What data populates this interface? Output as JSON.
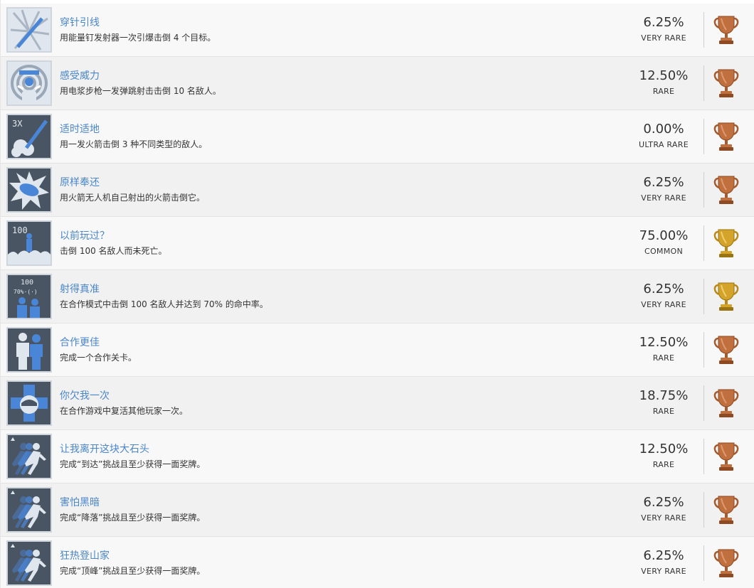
{
  "colors": {
    "title": "#4a86c8",
    "text": "#333333",
    "bronze": "#c0703f",
    "gold": "#d4a32a",
    "icon_bg": "#4a5563",
    "icon_blue": "#4a86d8",
    "icon_light": "#dfe6ee"
  },
  "achievements": [
    {
      "title": "穿针引线",
      "description": "用能量钉发射器一次引爆击倒 4 个目标。",
      "percent": "6.25%",
      "rarity": "VERY RARE",
      "trophy": "bronze",
      "icon": "nail-gun-burst-icon"
    },
    {
      "title": "感受威力",
      "description": "用电浆步枪一发弹跳射击击倒 10 名敌人。",
      "percent": "12.50%",
      "rarity": "RARE",
      "trophy": "bronze",
      "icon": "plasma-rifle-shock-icon"
    },
    {
      "title": "适时适地",
      "description": "用一发火箭击倒 3 种不同类型的敌人。",
      "percent": "0.00%",
      "rarity": "ULTRA RARE",
      "trophy": "bronze",
      "icon": "rocket-3x-icon",
      "badge": "3X"
    },
    {
      "title": "原样奉还",
      "description": "用火箭无人机自己射出的火箭击倒它。",
      "percent": "6.25%",
      "rarity": "VERY RARE",
      "trophy": "bronze",
      "icon": "drone-explosion-icon"
    },
    {
      "title": "以前玩过？",
      "description": "击倒 100 名敌人而未死亡。",
      "percent": "75.00%",
      "rarity": "COMMON",
      "trophy": "gold",
      "icon": "survivor-100-icon",
      "badge": "100"
    },
    {
      "title": "射得真准",
      "description": "在合作模式中击倒 100 名敌人并达到 70% 的命中率。",
      "percent": "6.25%",
      "rarity": "VERY RARE",
      "trophy": "gold",
      "icon": "coop-accuracy-icon",
      "badge": "100",
      "badge2": "70%·(·)"
    },
    {
      "title": "合作更佳",
      "description": "完成一个合作关卡。",
      "percent": "12.50%",
      "rarity": "RARE",
      "trophy": "bronze",
      "icon": "coop-partners-icon"
    },
    {
      "title": "你欠我一次",
      "description": "在合作游戏中复活其他玩家一次。",
      "percent": "18.75%",
      "rarity": "RARE",
      "trophy": "bronze",
      "icon": "revive-helmet-icon"
    },
    {
      "title": "让我离开这块大石头",
      "description": "完成“到达”挑战且至少获得一面奖牌。",
      "percent": "12.50%",
      "rarity": "RARE",
      "trophy": "bronze",
      "icon": "runner-challenge-icon"
    },
    {
      "title": "害怕黑暗",
      "description": "完成“降落”挑战且至少获得一面奖牌。",
      "percent": "6.25%",
      "rarity": "VERY RARE",
      "trophy": "bronze",
      "icon": "runner-challenge-icon"
    },
    {
      "title": "狂热登山家",
      "description": "完成“顶峰”挑战且至少获得一面奖牌。",
      "percent": "6.25%",
      "rarity": "VERY RARE",
      "trophy": "bronze",
      "icon": "runner-challenge-icon"
    }
  ]
}
